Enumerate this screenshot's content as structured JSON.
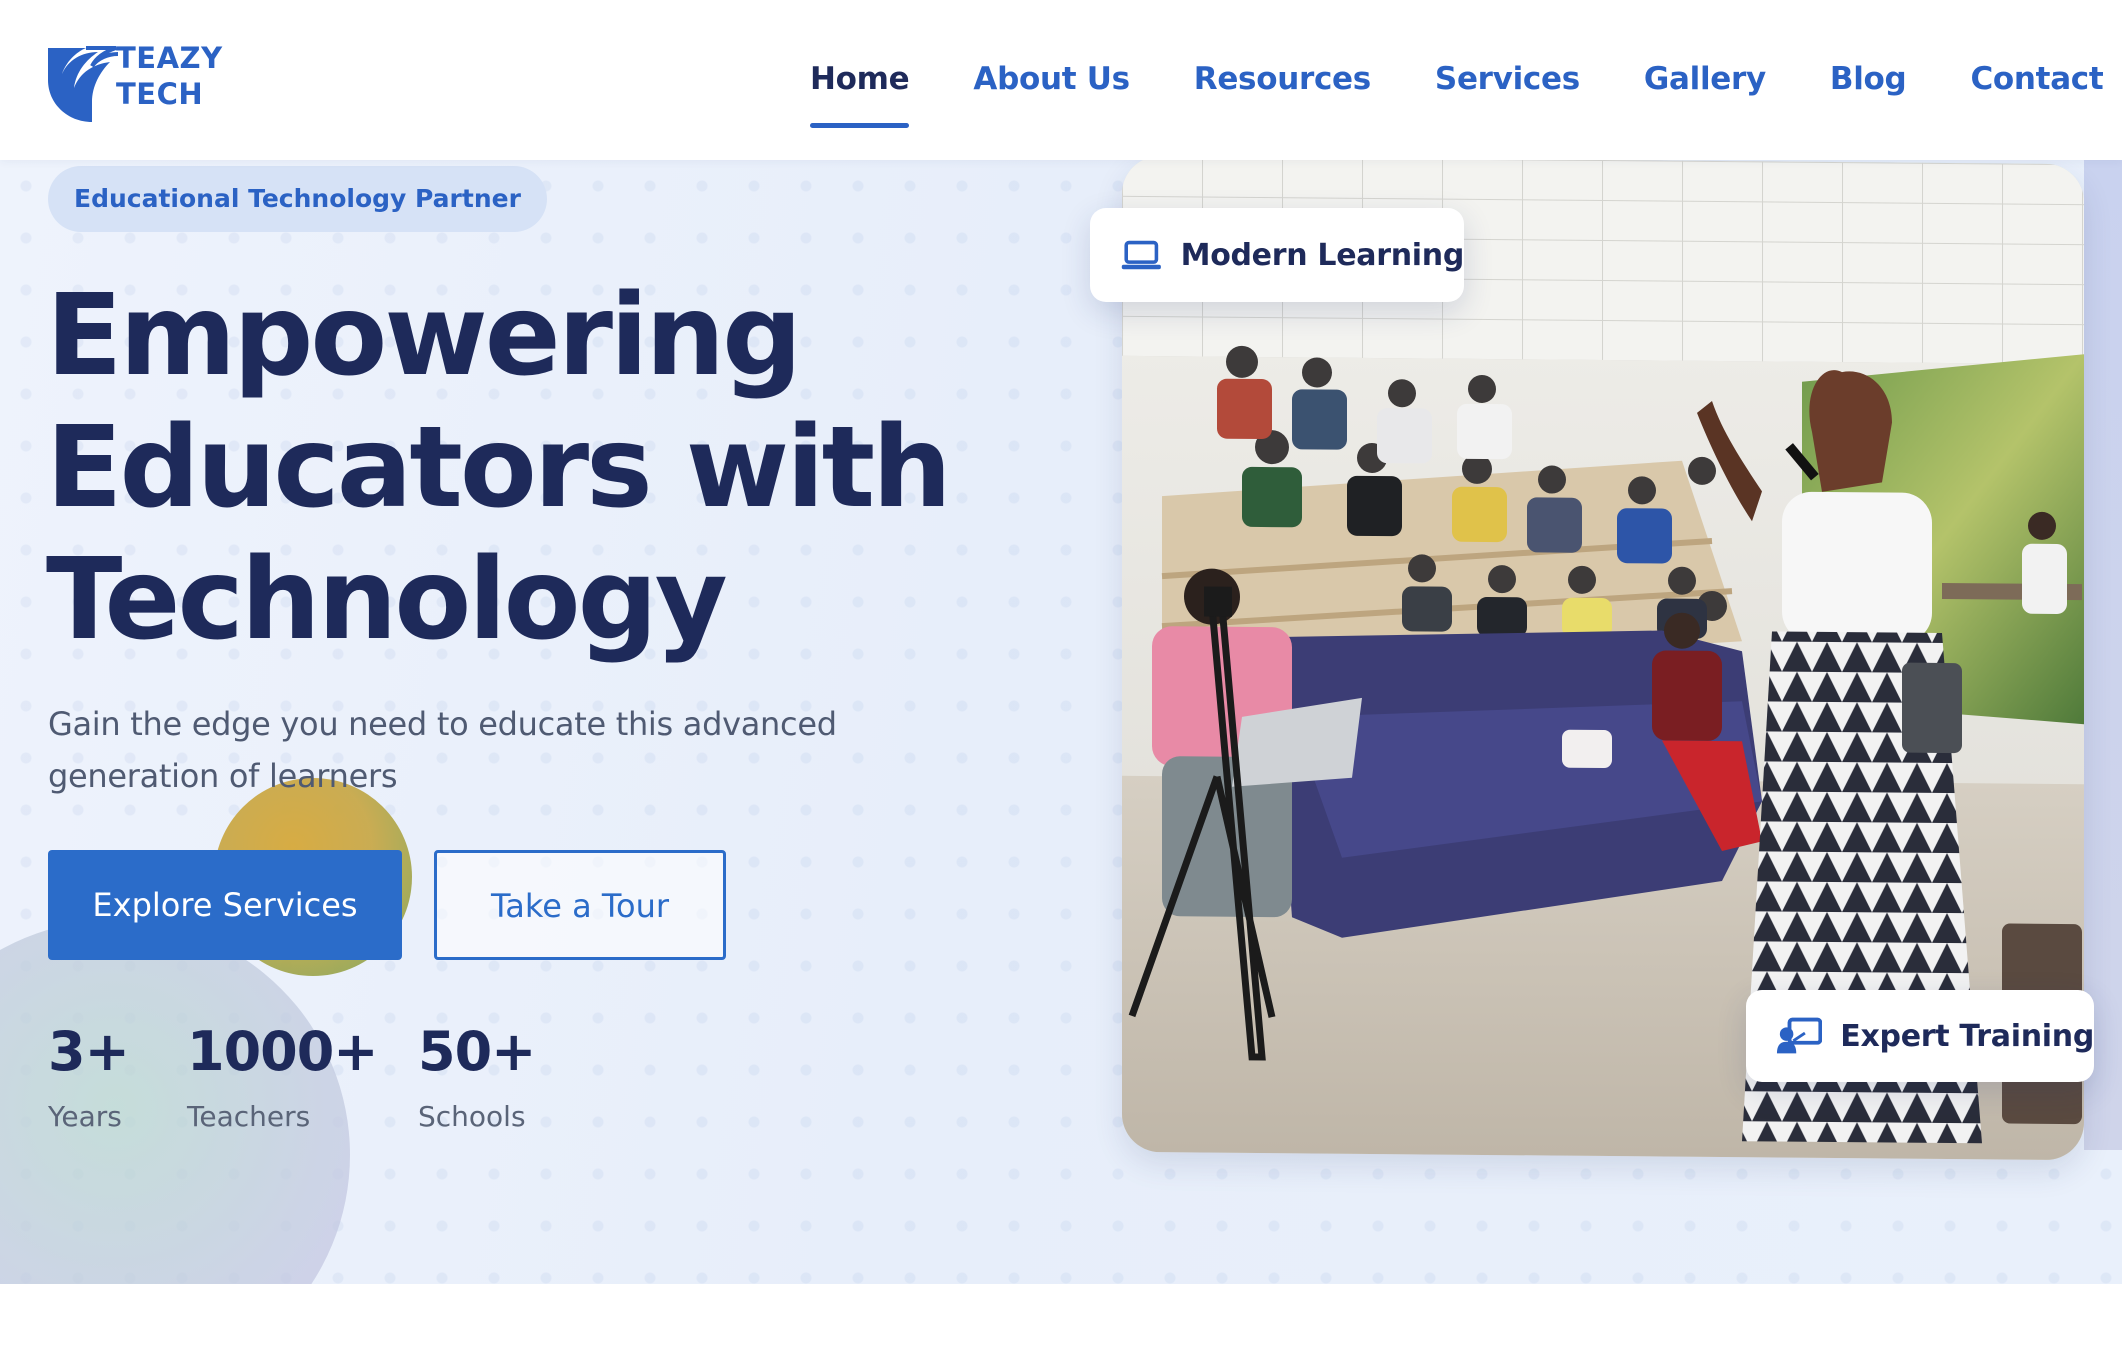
{
  "brand": {
    "logo_line1": "TEAZY",
    "logo_line2": "TECH",
    "accent_color": "#2b62c4",
    "dark_color": "#1e2a5a"
  },
  "nav": {
    "items": [
      {
        "label": "Home",
        "active": true
      },
      {
        "label": "About Us",
        "active": false
      },
      {
        "label": "Resources",
        "active": false
      },
      {
        "label": "Services",
        "active": false
      },
      {
        "label": "Gallery",
        "active": false
      },
      {
        "label": "Blog",
        "active": false
      },
      {
        "label": "Contact",
        "active": false
      }
    ]
  },
  "hero": {
    "eyebrow": "Educational Technology Partner",
    "headline": [
      "Empowering",
      "Educators with",
      "Technology"
    ],
    "subtext": "Gain the edge you need to educate this advanced generation of learners",
    "primary_button": "Explore Services",
    "secondary_button": "Take a Tour",
    "stats": [
      {
        "value": "3+",
        "label": "Years"
      },
      {
        "value": "1000+",
        "label": "Teachers"
      },
      {
        "value": "50+",
        "label": "Schools"
      }
    ]
  },
  "photo": {
    "badge_top": {
      "label": "Modern Learning",
      "icon": "laptop-icon"
    },
    "badge_bottom": {
      "label": "Expert Training",
      "icon": "presenter-icon"
    }
  }
}
